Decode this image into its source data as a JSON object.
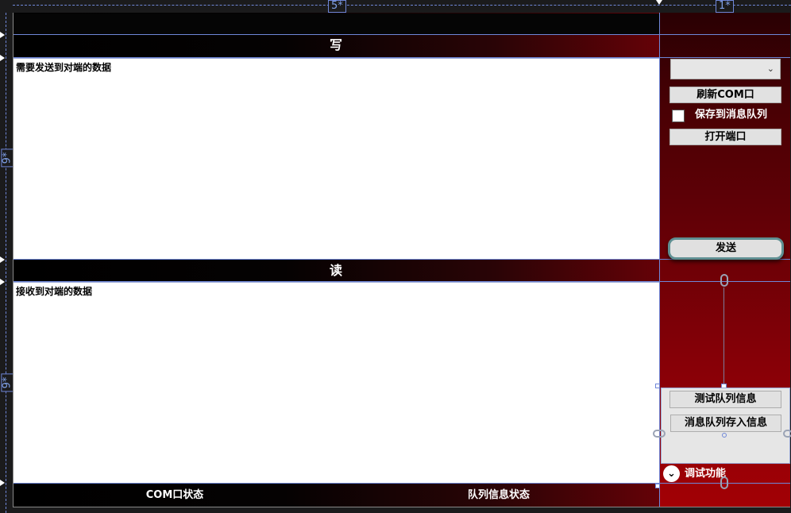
{
  "rulers": {
    "column_left": "5*",
    "column_right": "1*",
    "row_top": "9*",
    "row_bottom": "9*"
  },
  "write_section": {
    "title": "写",
    "textbox_text": "需要发送到对端的数据"
  },
  "read_section": {
    "title": "读",
    "textbox_text": "接收到对端的数据"
  },
  "controls": {
    "com_port_select_value": "",
    "refresh_com_label": "刷新COM口",
    "save_to_queue_label": "保存到消息队列",
    "save_to_queue_checked": false,
    "open_port_label": "打开端口",
    "send_label": "发送"
  },
  "debug": {
    "test_queue_label": "测试队列信息",
    "queue_store_label": "消息队列存入信息",
    "expander_label": "调试功能",
    "expander_icon": "chevron-down-icon"
  },
  "status_bar": {
    "com_status": "COM口状态",
    "queue_status": "队列信息状态"
  }
}
